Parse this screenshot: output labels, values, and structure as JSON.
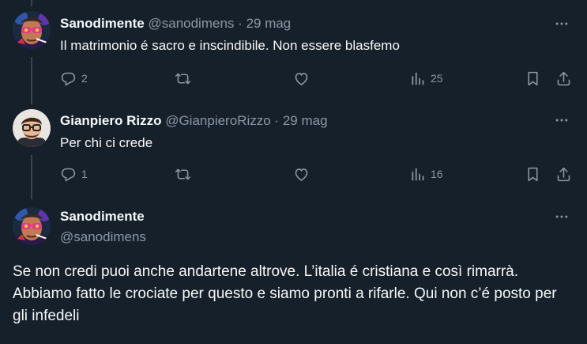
{
  "tweet1": {
    "name": "Sanodimente",
    "handle": "@sanodimens",
    "dot": "·",
    "date": "29 mag",
    "text": "Il matrimonio é sacro e inscindibile. Non essere blasfemo",
    "replies": "2",
    "views": "25"
  },
  "tweet2": {
    "name": "Gianpiero Rizzo",
    "handle": "@GianpieroRizzo",
    "dot": "·",
    "date": "29 mag",
    "text": "Per chi ci crede",
    "replies": "1",
    "views": "16"
  },
  "tweet3": {
    "name": "Sanodimente",
    "handle": "@sanodimens",
    "text": "Se non credi puoi anche andartene altrove. L’italia é cristiana e così rimarrà. Abbiamo fatto le crociate per questo e siamo pronti a rifarle. Qui non c’é posto per gli infedeli"
  },
  "icons": {
    "reply": "reply-icon",
    "retweet": "retweet-icon",
    "like": "heart-icon",
    "views": "views-icon",
    "bookmark": "bookmark-icon",
    "share": "share-icon",
    "more": "more-icon"
  },
  "colors": {
    "background": "#15202b",
    "text": "#f7f9f9",
    "muted": "#8b98a5",
    "thread": "#38444d"
  }
}
